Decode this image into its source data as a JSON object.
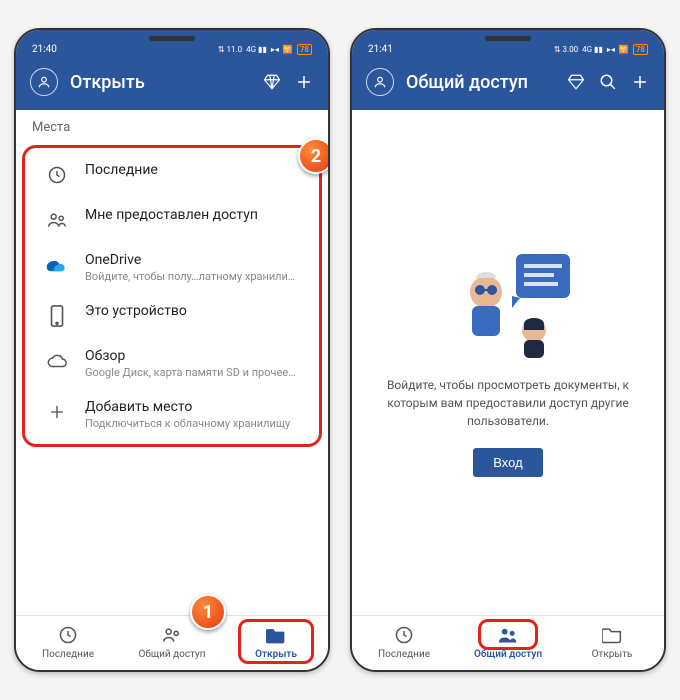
{
  "screens": [
    {
      "status": {
        "time": "21:40",
        "net1": "11.0\nKB/s",
        "sim": "Yes 4G",
        "wifi": "wifi",
        "batt": "78"
      },
      "title": "Открыть",
      "section": "Места",
      "items": [
        {
          "icon": "clock",
          "title": "Последние"
        },
        {
          "icon": "people",
          "title": "Мне предоставлен доступ"
        },
        {
          "icon": "onedrive",
          "title": "OneDrive",
          "sub": "Войдите, чтобы полу…латному хранилищу"
        },
        {
          "icon": "phone",
          "title": "Это устройство"
        },
        {
          "icon": "cloud",
          "title": "Обзор",
          "sub": "Google Диск, карта памяти SD и прочее…"
        },
        {
          "icon": "plus",
          "title": "Добавить место",
          "sub": "Подключиться к облачному хранилищу"
        }
      ],
      "nav": [
        {
          "icon": "clock",
          "label": "Последние"
        },
        {
          "icon": "people",
          "label": "Общий доступ"
        },
        {
          "icon": "folder",
          "label": "Открыть",
          "active": true
        }
      ],
      "callouts": {
        "one": "1",
        "two": "2"
      }
    },
    {
      "status": {
        "time": "21:41",
        "net1": "3.00\nKB/s",
        "sim": "Yes 4G",
        "wifi": "wifi",
        "batt": "78"
      },
      "title": "Общий доступ",
      "empty_text": "Войдите, чтобы просмотреть документы, к которым вам предоставили доступ другие пользователи.",
      "login": "Вход",
      "nav": [
        {
          "icon": "clock",
          "label": "Последние"
        },
        {
          "icon": "people",
          "label": "Общий доступ",
          "active": true
        },
        {
          "icon": "folder",
          "label": "Открыть"
        }
      ]
    }
  ]
}
